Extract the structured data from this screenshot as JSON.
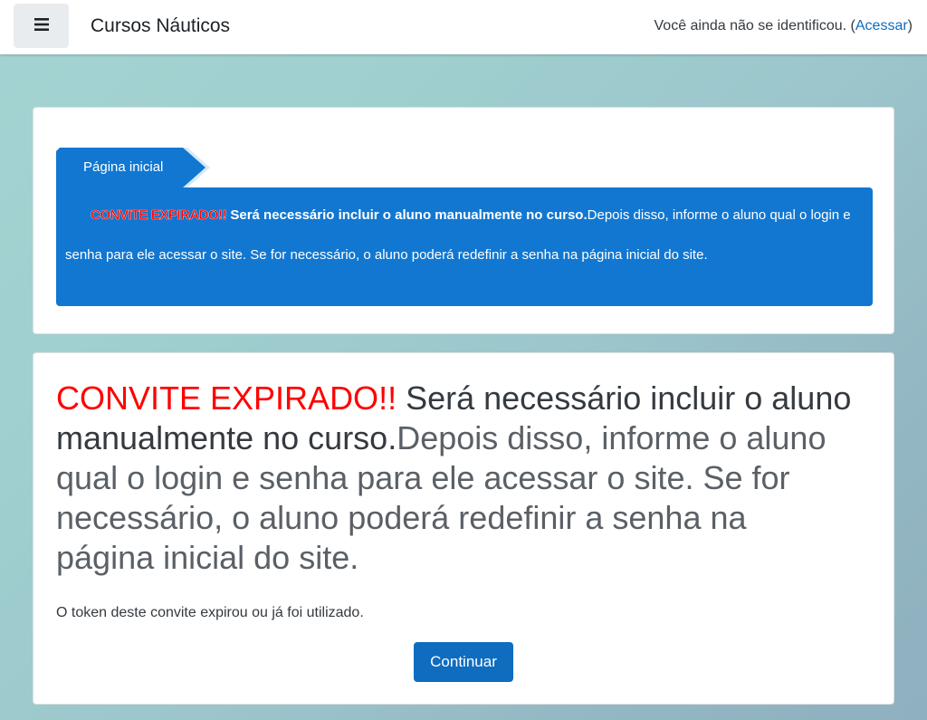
{
  "navbar": {
    "menu_icon": "hamburger-icon",
    "site_name": "Cursos Náuticos",
    "login_prefix": "Você ainda não se identificou. (",
    "login_link": "Acessar",
    "login_suffix": ")"
  },
  "breadcrumb": {
    "item": "Página inicial"
  },
  "notice": {
    "alert": "CONVITE EXPIRADO!!",
    "bold_text": " Será necessário incluir o aluno manualmente no curso.",
    "rest_text": "Depois disso, informe o aluno qual o login e senha para ele acessar o site. Se for necessário, o aluno poderá redefinir a senha na página inicial do site."
  },
  "main": {
    "heading_alert": "CONVITE EXPIRADO!!",
    "heading_bold": " Será necessário incluir o aluno manualmente no curso.",
    "heading_rest": "Depois disso, informe o aluno qual o login e senha para ele acessar o site. Se for necessário, o aluno poderá redefinir a senha na página inicial do site.",
    "token_message": "O token deste convite expirou ou já foi utilizado.",
    "continue_label": "Continuar"
  },
  "colors": {
    "primary": "#0f6cbf",
    "notice_bg": "#1177d1",
    "alert_red": "#ff0000"
  }
}
